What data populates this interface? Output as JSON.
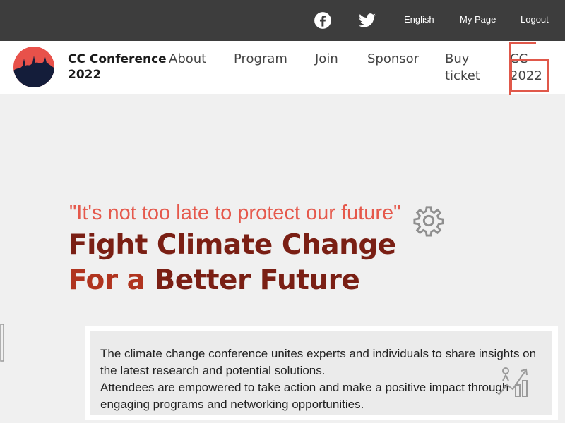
{
  "topbar": {
    "icons": [
      "facebook-icon",
      "twitter-icon"
    ],
    "links": {
      "english": "English",
      "my_page": "My Page",
      "logout": "Logout"
    }
  },
  "navbar": {
    "brand": "CC Conference 2022",
    "links": {
      "about": "About",
      "program": "Program",
      "join": "Join",
      "sponsor": "Sponsor",
      "buy_ticket": "Buy ticket",
      "cc_2022": "CC 2022"
    }
  },
  "hero": {
    "quote": "\"It's not too late to protect our future\"",
    "headline_line1": "Fight Climate Change",
    "headline_line2_prefix": "For a",
    "headline_line2_rest": " Better Future"
  },
  "intro": {
    "paragraph1": "The climate change conference unites experts and individuals to share insights on the latest research and potential solutions.",
    "paragraph2": "Attendees are empowered to take action and make a positive impact through engaging programs and networking opportunities."
  },
  "colors": {
    "topbar_bg": "#3d3d3d",
    "accent_red": "#e5584b",
    "headline_dark": "#7a1f14",
    "page_bg": "#f0f0f0"
  }
}
